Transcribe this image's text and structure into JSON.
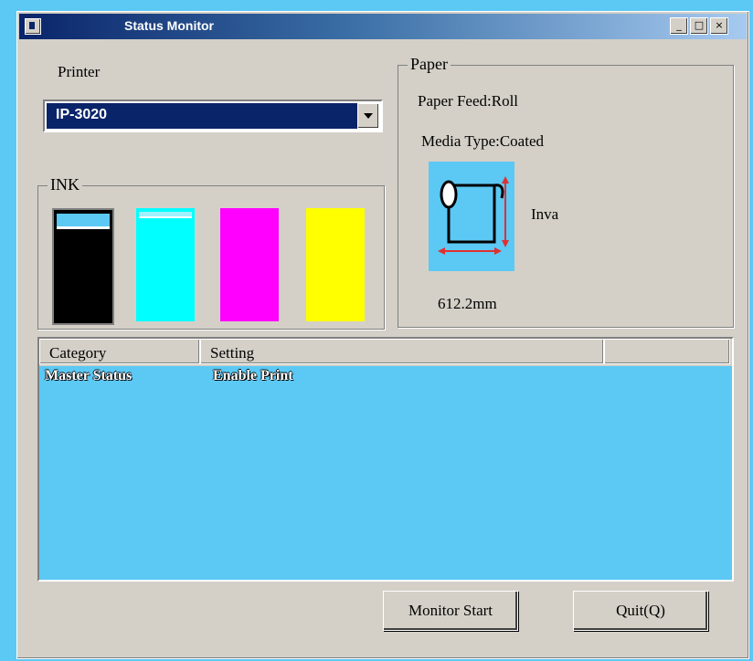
{
  "window": {
    "title": "Status Monitor",
    "buttons": {
      "minimize": "_",
      "maximize": "□",
      "close": "×"
    }
  },
  "printer": {
    "label": "Printer",
    "selected": "IP-3020"
  },
  "ink": {
    "label": "INK",
    "cartridges": [
      {
        "name": "black",
        "color": "#000000"
      },
      {
        "name": "cyan",
        "color": "#00ffff"
      },
      {
        "name": "magenta",
        "color": "#ff00ff"
      },
      {
        "name": "yellow",
        "color": "#ffff00"
      }
    ]
  },
  "paper": {
    "label": "Paper",
    "feed": "Paper Feed:Roll",
    "media_type": "Media Type:Coated",
    "status": "Inva",
    "length": "612.2mm"
  },
  "table": {
    "columns": [
      "Category",
      "Setting"
    ],
    "rows": [
      [
        "Master Status",
        "Enable Print"
      ]
    ]
  },
  "buttons": {
    "monitor_start": "Monitor Start",
    "quit": "Quit(Q)"
  },
  "colors": {
    "accent": "#0a246a",
    "background": "#5cc8f4"
  }
}
